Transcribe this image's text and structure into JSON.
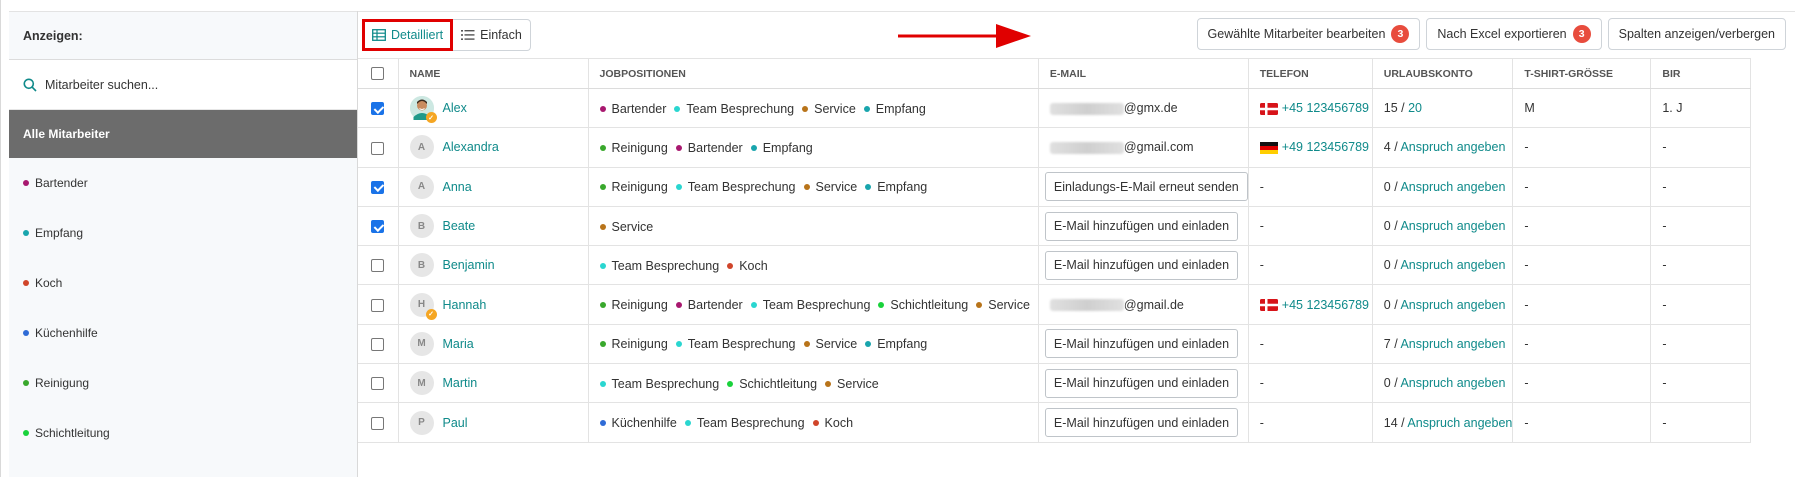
{
  "sidebar": {
    "title": "Anzeigen:",
    "search_placeholder": "Mitarbeiter suchen...",
    "all_label": "Alle Mitarbeiter",
    "items": [
      {
        "label": "Bartender",
        "color": "#a8186f"
      },
      {
        "label": "Empfang",
        "color": "#19a5ad"
      },
      {
        "label": "Koch",
        "color": "#d0452a"
      },
      {
        "label": "Küchenhilfe",
        "color": "#2f6bd6"
      },
      {
        "label": "Reinigung",
        "color": "#39a82c"
      },
      {
        "label": "Schichtleitung",
        "color": "#19d23b"
      }
    ]
  },
  "toolbar": {
    "tab_detailed": "Detailliert",
    "tab_simple": "Einfach",
    "edit_label": "Gewählte Mitarbeiter bearbeiten",
    "edit_count": "3",
    "export_label": "Nach Excel exportieren",
    "export_count": "3",
    "columns_label": "Spalten anzeigen/verbergen"
  },
  "table": {
    "headers": [
      "NAME",
      "JOBPOSITIONEN",
      "E-MAIL",
      "TELEFON",
      "URLAUBSKONTO",
      "T-SHIRT-GRÖSSE",
      "BIR"
    ],
    "position_colors": {
      "Bartender": "#a8186f",
      "Team Besprechung": "#2ad6d0",
      "Service": "#b8741a",
      "Empfang": "#19a5ad",
      "Reinigung": "#39a82c",
      "Schichtleitung": "#19d23b",
      "Küchenhilfe": "#2f6bd6",
      "Koch": "#d0452a"
    },
    "rows": [
      {
        "checked": true,
        "initial": "",
        "photo": true,
        "verified": true,
        "name": "Alex",
        "positions": [
          "Bartender",
          "Team Besprechung",
          "Service",
          "Empfang"
        ],
        "email_suffix": "@gmx.de",
        "email_button": "",
        "flag": "dk",
        "phone": "+45 123456789",
        "vac_used": "15",
        "vac_sep": " / ",
        "vac_link": "20",
        "tshirt": "M",
        "bir": "1. J"
      },
      {
        "checked": false,
        "initial": "A",
        "photo": false,
        "verified": false,
        "name": "Alexandra",
        "positions": [
          "Reinigung",
          "Bartender",
          "Empfang"
        ],
        "email_suffix": "@gmail.com",
        "email_button": "",
        "flag": "de",
        "phone": "+49 123456789",
        "vac_used": "4",
        "vac_sep": " / ",
        "vac_link": "Anspruch angeben",
        "tshirt": "-",
        "bir": "-"
      },
      {
        "checked": true,
        "initial": "A",
        "photo": false,
        "verified": false,
        "name": "Anna",
        "positions": [
          "Reinigung",
          "Team Besprechung",
          "Service",
          "Empfang"
        ],
        "email_suffix": "",
        "email_button": "Einladungs-E-Mail erneut senden",
        "flag": "",
        "phone": "-",
        "vac_used": "0",
        "vac_sep": " / ",
        "vac_link": "Anspruch angeben",
        "tshirt": "-",
        "bir": "-"
      },
      {
        "checked": true,
        "initial": "B",
        "photo": false,
        "verified": false,
        "name": "Beate",
        "positions": [
          "Service"
        ],
        "email_suffix": "",
        "email_button": "E-Mail hinzufügen und einladen",
        "flag": "",
        "phone": "-",
        "vac_used": "0",
        "vac_sep": " / ",
        "vac_link": "Anspruch angeben",
        "tshirt": "-",
        "bir": "-"
      },
      {
        "checked": false,
        "initial": "B",
        "photo": false,
        "verified": false,
        "name": "Benjamin",
        "positions": [
          "Team Besprechung",
          "Koch"
        ],
        "email_suffix": "",
        "email_button": "E-Mail hinzufügen und einladen",
        "flag": "",
        "phone": "-",
        "vac_used": "0",
        "vac_sep": " / ",
        "vac_link": "Anspruch angeben",
        "tshirt": "-",
        "bir": "-"
      },
      {
        "checked": false,
        "initial": "H",
        "photo": false,
        "verified": true,
        "name": "Hannah",
        "positions": [
          "Reinigung",
          "Bartender",
          "Team Besprechung",
          "Schichtleitung",
          "Service"
        ],
        "email_suffix": "@gmail.de",
        "email_button": "",
        "flag": "dk",
        "phone": "+45 123456789",
        "vac_used": "0",
        "vac_sep": " / ",
        "vac_link": "Anspruch angeben",
        "tshirt": "-",
        "bir": "-"
      },
      {
        "checked": false,
        "initial": "M",
        "photo": false,
        "verified": false,
        "name": "Maria",
        "positions": [
          "Reinigung",
          "Team Besprechung",
          "Service",
          "Empfang"
        ],
        "email_suffix": "",
        "email_button": "E-Mail hinzufügen und einladen",
        "flag": "",
        "phone": "-",
        "vac_used": "7",
        "vac_sep": " / ",
        "vac_link": "Anspruch angeben",
        "tshirt": "-",
        "bir": "-"
      },
      {
        "checked": false,
        "initial": "M",
        "photo": false,
        "verified": false,
        "name": "Martin",
        "positions": [
          "Team Besprechung",
          "Schichtleitung",
          "Service"
        ],
        "email_suffix": "",
        "email_button": "E-Mail hinzufügen und einladen",
        "flag": "",
        "phone": "-",
        "vac_used": "0",
        "vac_sep": " / ",
        "vac_link": "Anspruch angeben",
        "tshirt": "-",
        "bir": "-"
      },
      {
        "checked": false,
        "initial": "P",
        "photo": false,
        "verified": false,
        "name": "Paul",
        "positions": [
          "Küchenhilfe",
          "Team Besprechung",
          "Koch"
        ],
        "email_suffix": "",
        "email_button": "E-Mail hinzufügen und einladen",
        "flag": "",
        "phone": "-",
        "vac_used": "14",
        "vac_sep": " / ",
        "vac_link": "Anspruch angeben",
        "tshirt": "-",
        "bir": "-"
      }
    ]
  }
}
